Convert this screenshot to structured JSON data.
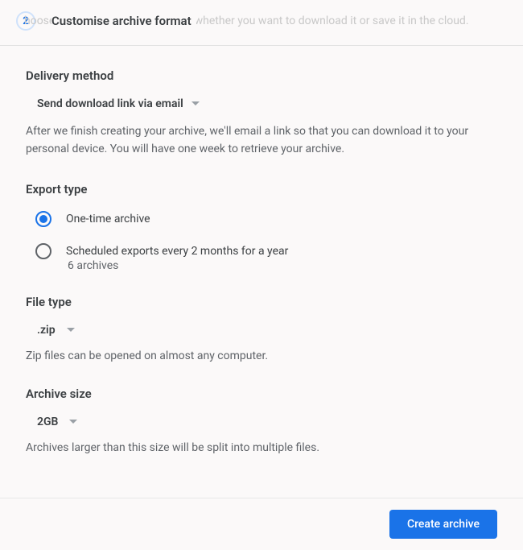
{
  "header": {
    "faded_bg_text": "hoose the file type, frequency and whether you want to download it or save it in the cloud.",
    "step_number": "2",
    "title": "Customise archive format"
  },
  "delivery": {
    "title": "Delivery method",
    "selected": "Send download link via email",
    "helper": "After we finish creating your archive, we'll email a link so that you can download it to your personal device. You will have one week to retrieve your archive."
  },
  "export_type": {
    "title": "Export type",
    "options": [
      {
        "label": "One-time archive",
        "checked": true
      },
      {
        "label": "Scheduled exports every 2 months for a year",
        "checked": false,
        "sub": "6 archives"
      }
    ]
  },
  "file_type": {
    "title": "File type",
    "selected": ".zip",
    "helper": "Zip files can be opened on almost any computer."
  },
  "archive_size": {
    "title": "Archive size",
    "selected": "2GB",
    "helper": "Archives larger than this size will be split into multiple files."
  },
  "footer": {
    "primary_button": "Create archive"
  }
}
